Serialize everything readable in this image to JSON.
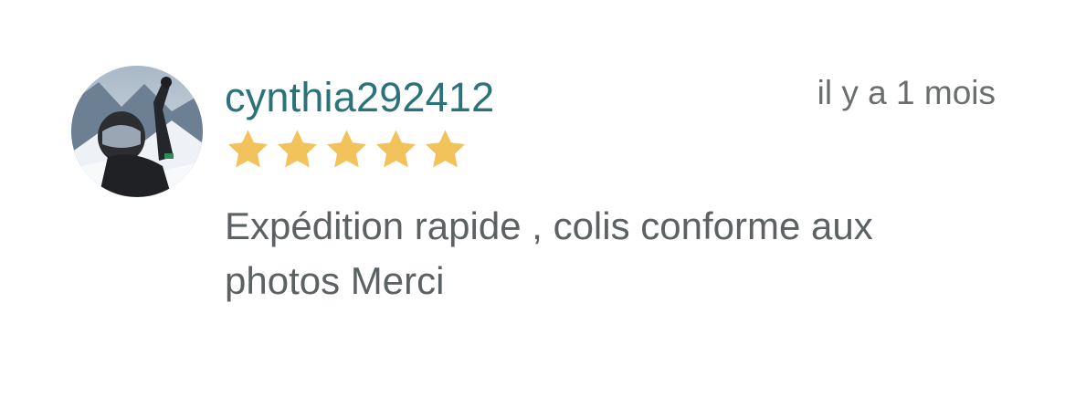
{
  "review": {
    "username": "cynthia292412",
    "timestamp": "il y a 1 mois",
    "rating": 5,
    "rating_max": 5,
    "text": "Expédition rapide , colis conforme aux photos Merci"
  },
  "colors": {
    "username": "#2b737a",
    "star": "#f2c25b",
    "text": "#5c6263",
    "timestamp": "#6a6e6f"
  },
  "icons": {
    "star": "star-icon"
  }
}
